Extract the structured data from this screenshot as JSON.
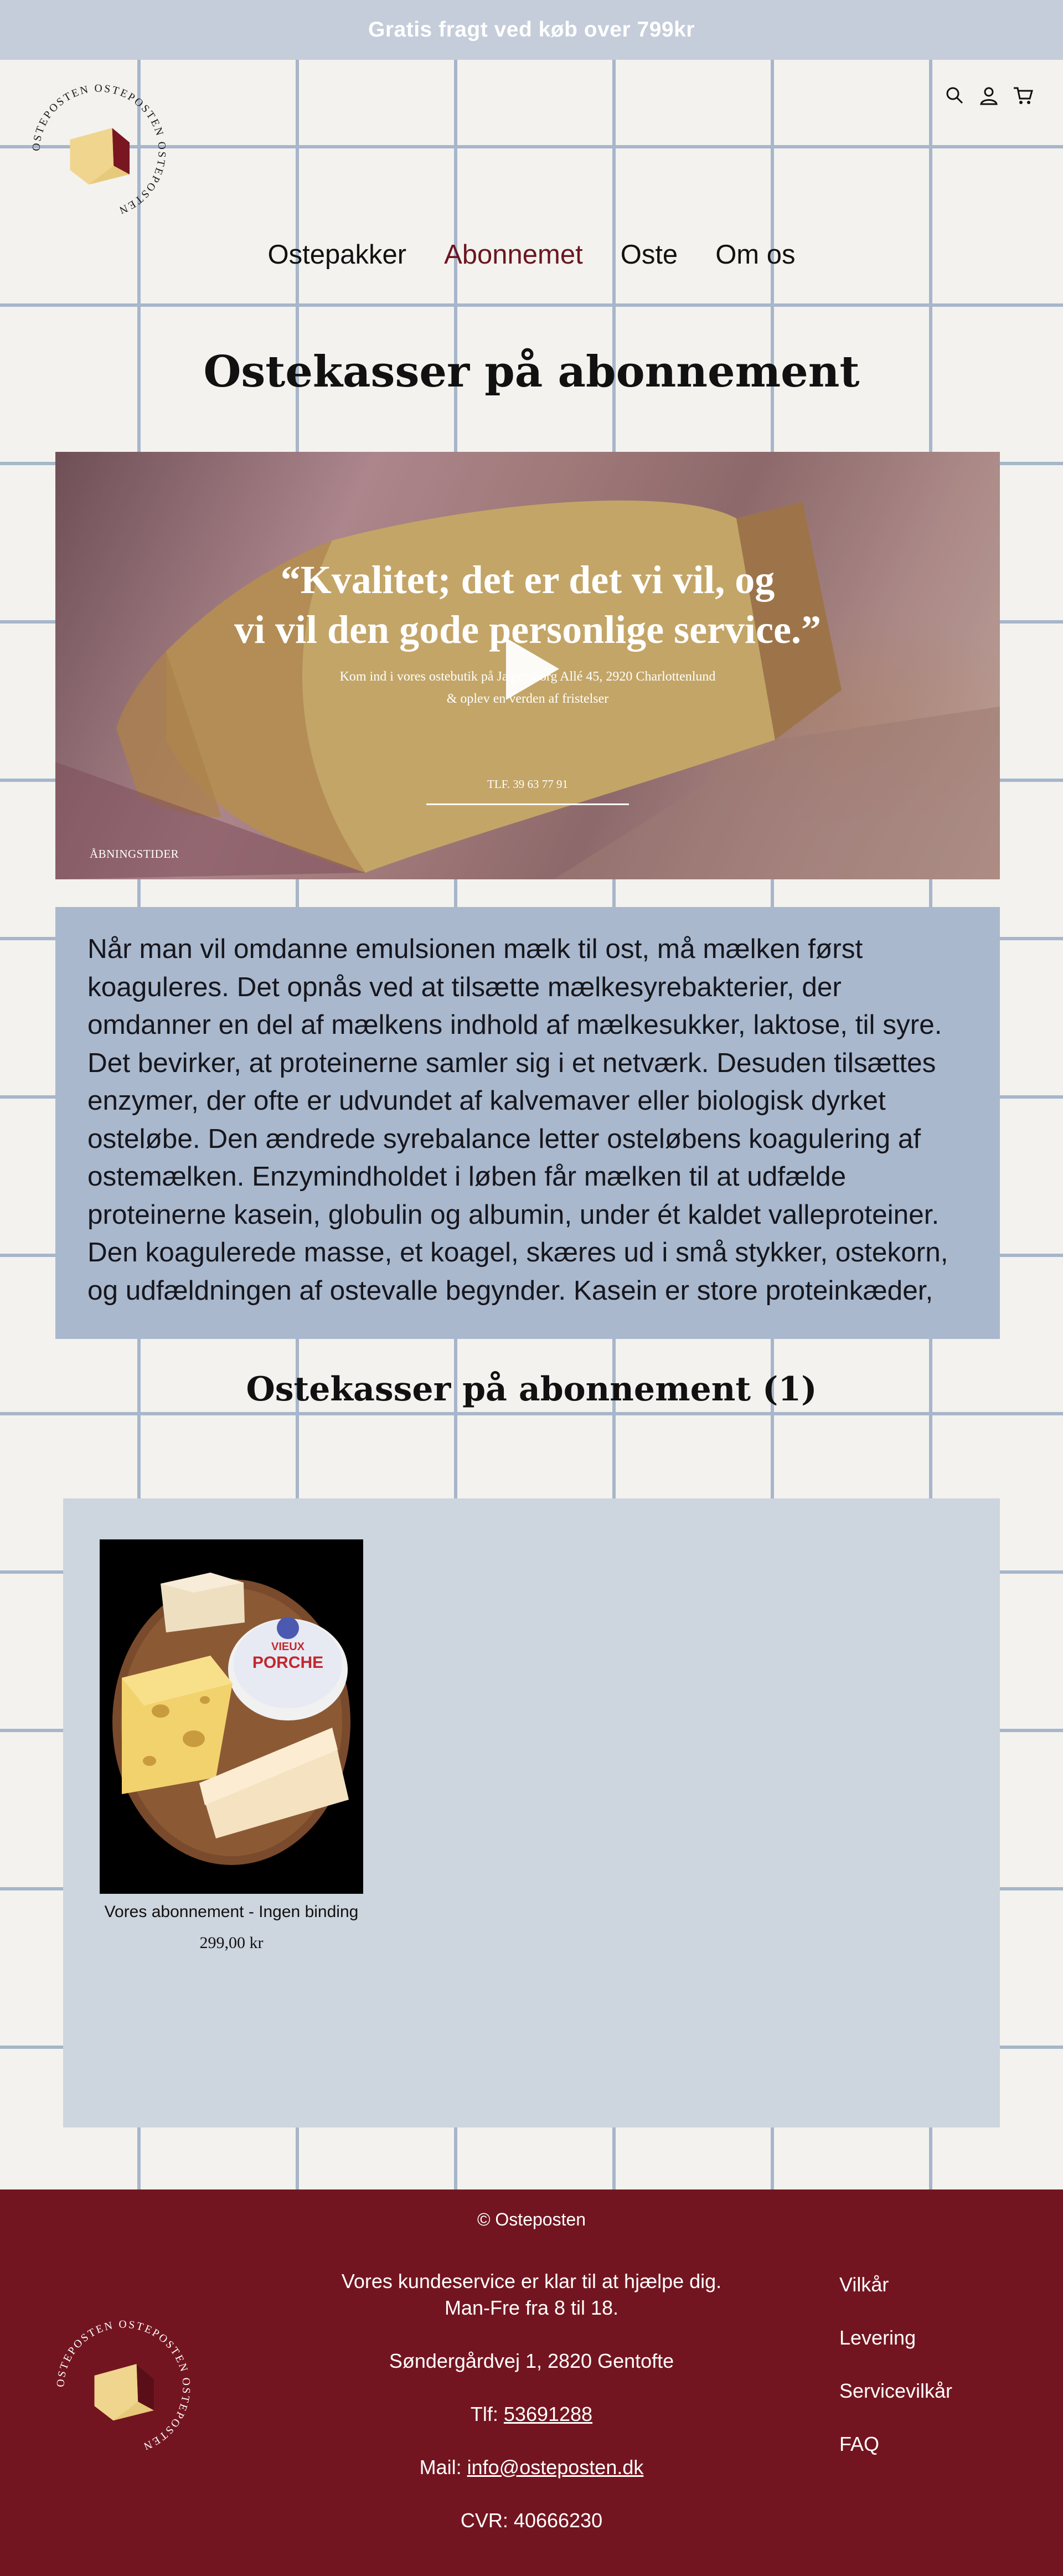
{
  "announcement": {
    "text": "Gratis fragt ved køb over 799kr"
  },
  "logo": {
    "text": "OSTEPOSTEN OSTEPOSTEN OSTEPOSTEN"
  },
  "header_icons": [
    "search-icon",
    "account-icon",
    "cart-icon"
  ],
  "nav": {
    "items": [
      {
        "label": "Ostepakker",
        "active": false
      },
      {
        "label": "Abonnemet",
        "active": true
      },
      {
        "label": "Oste",
        "active": false
      },
      {
        "label": "Om os",
        "active": false
      }
    ]
  },
  "page": {
    "title": "Ostekasser på abonnement"
  },
  "hero": {
    "quote_line1": "“Kvalitet; det er det vi vil, og",
    "quote_line2": "vi vil den gode personlige service.”",
    "sub_line1": "Kom ind i vores ostebutik på Jægersborg Allé 45, 2920 Charlottenlund",
    "sub_line2": "& oplev en verden af fristelser",
    "tel": "TLF. 39 63 77 91",
    "hours": "ÅBNINGSTIDER"
  },
  "intro": {
    "text": "Når man vil omdanne emulsionen mælk til ost, må mælken først koaguleres. Det opnås ved at tilsætte mælkesyrebakterier, der omdanner en del af mælkens indhold af mælkesukker, laktose, til syre. Det bevirker, at proteinerne samler sig i et netværk. Desuden tilsættes enzymer, der ofte er udvundet af kalvemaver eller biologisk dyrket osteløbe. Den ændrede syrebalance letter osteløbens koagulering af ostemælken. Enzymindholdet i løben får mælken til at udfælde proteinerne kasein, globulin og albumin, under ét kaldet valleproteiner. Den koagulerede masse, et koagel, skæres ud i små stykker, ostekorn, og udfældningen af ostevalle begynder. Kasein er store proteinkæder,"
  },
  "collection": {
    "title": "Ostekasser på abonnement (1)"
  },
  "products": [
    {
      "name": "Vores abonnement - Ingen binding",
      "price": "299,00 kr",
      "label_top": "VIEUX",
      "label_bottom": "PORCHE"
    }
  ],
  "footer": {
    "copyright": "© Osteposten",
    "service_line1": "Vores kundeservice er klar til at hjælpe dig.",
    "service_line2": "Man-Fre fra 8 til 18.",
    "address": "Søndergårdvej 1, 2820 Gentofte",
    "phone_label": "Tlf: ",
    "phone": "53691288",
    "mail_label": "Mail: ",
    "email": "info@osteposten.dk",
    "cvr": "CVR: 40666230",
    "links": [
      "Vilkår",
      "Levering",
      "Servicevilkår",
      "FAQ"
    ]
  },
  "colors": {
    "brand": "#731520",
    "announcement_bg": "#c4cdd9",
    "grid_line": "#a7b6ca",
    "intro_bg": "#a9b8cd",
    "product_grid_bg": "#cdd5de",
    "page_bg": "#f3f2ef"
  }
}
